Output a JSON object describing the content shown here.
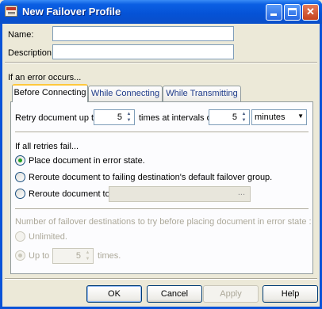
{
  "window": {
    "title": "New Failover Profile"
  },
  "form": {
    "name_label": "Name:",
    "name_value": "",
    "description_label": "Description:",
    "description_value": "",
    "error_heading": "If an error occurs..."
  },
  "tabs": [
    {
      "label": "Before Connecting",
      "active": true
    },
    {
      "label": "While Connecting",
      "active": false
    },
    {
      "label": "While Transmitting",
      "active": false
    }
  ],
  "retry": {
    "label_before": "Retry document up to",
    "count": "5",
    "label_middle": "times at intervals of",
    "interval": "5",
    "unit": "minutes"
  },
  "all_fail": {
    "heading": "If all retries fail...",
    "opt_error": "Place document in error state.",
    "opt_default_group": "Reroute document to failing destination's default failover group.",
    "opt_reroute": "Reroute document to",
    "reroute_value": "",
    "browse_label": "..."
  },
  "destinations": {
    "heading": "Number of failover destinations to try before placing document in error state :",
    "opt_unlimited": "Unlimited.",
    "opt_upto": "Up to",
    "upto_value": "5",
    "times_label": "times."
  },
  "buttons": {
    "ok": "OK",
    "cancel": "Cancel",
    "apply": "Apply",
    "help": "Help"
  }
}
